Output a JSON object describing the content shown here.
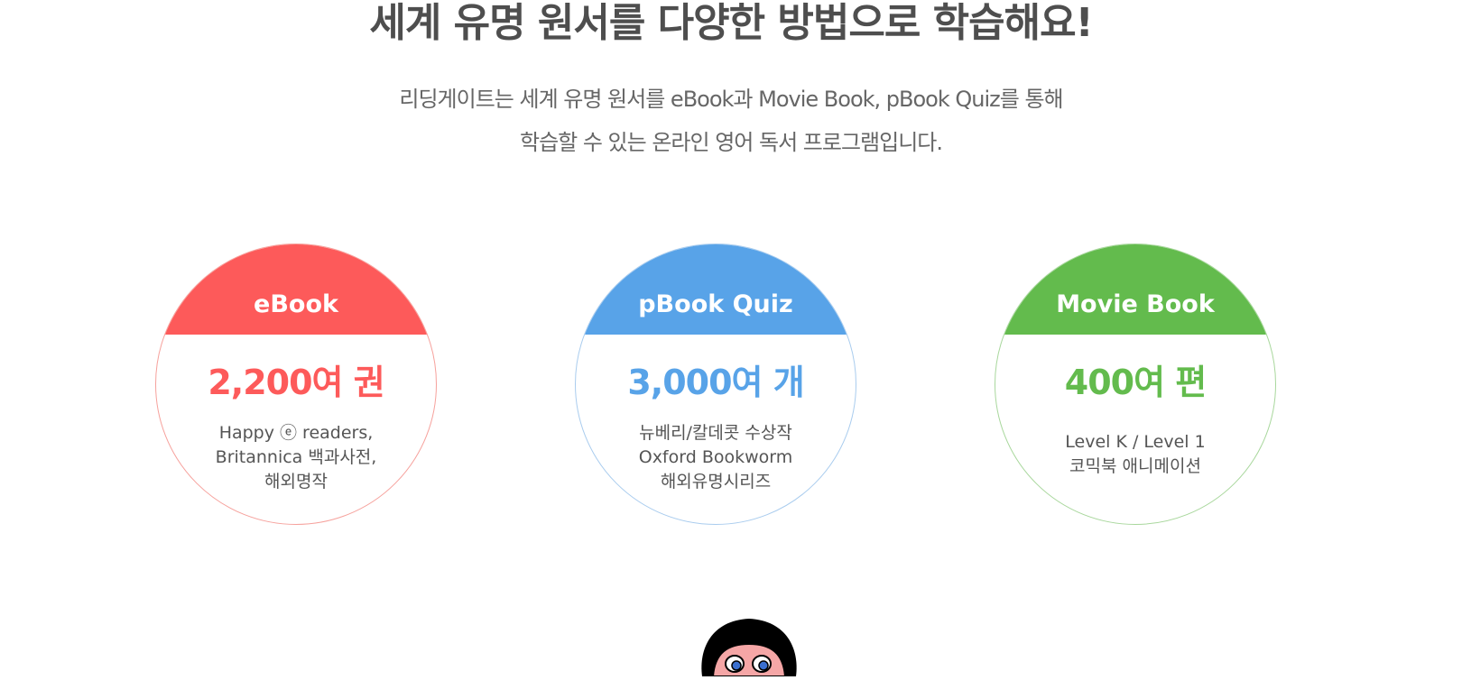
{
  "headline": "세계 유명 원서를 다양한 방법으로 학습해요!",
  "intro": {
    "line1": "리딩게이트는 세계 유명 원서를 eBook과 Movie Book, pBook Quiz를 통해",
    "line2": "학습할 수 있는 온라인 영어 독서 프로그램입니다."
  },
  "cards": [
    {
      "title": "eBook",
      "count": "2,200여 권",
      "desc": [
        "Happy ⓔ readers,",
        "Britannica 백과사전,",
        "해외명작"
      ],
      "color": "#fd5a5a"
    },
    {
      "title": "pBook Quiz",
      "count": "3,000여 개",
      "desc": [
        "뉴베리/칼데콧 수상작",
        "Oxford Bookworm",
        "해외유명시리즈"
      ],
      "color": "#58a3e8"
    },
    {
      "title": "Movie Book",
      "count": "400여 편",
      "desc": [
        "Level K / Level 1",
        "코믹북 애니메이션"
      ],
      "color": "#63bb4d"
    }
  ],
  "mascot": {
    "icon": "girl-character-icon"
  }
}
